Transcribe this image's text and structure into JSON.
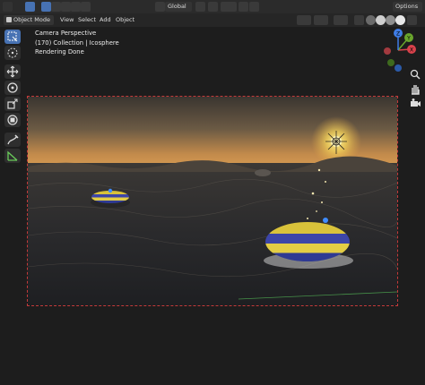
{
  "header": {
    "mode": "Object Mode",
    "menus": [
      "View",
      "Select",
      "Add",
      "Object"
    ],
    "orientation": "Global",
    "options_label": "Options"
  },
  "overlay": {
    "line1": "Camera Perspective",
    "line2": "(170) Collection | Icosphere",
    "line3": "Rendering Done"
  },
  "axes": {
    "x": "X",
    "y": "Y",
    "z": "Z"
  },
  "colors": {
    "accent": "#4772b3",
    "axis_x": "#d9424b",
    "axis_y": "#6aa62d",
    "axis_z": "#3f7de6",
    "frame": "#c43a3a"
  },
  "toolbar_icons": [
    "select-box-icon",
    "cursor-icon",
    "move-icon",
    "rotate-icon",
    "scale-icon",
    "transform-icon",
    "annotate-icon",
    "measure-icon"
  ]
}
